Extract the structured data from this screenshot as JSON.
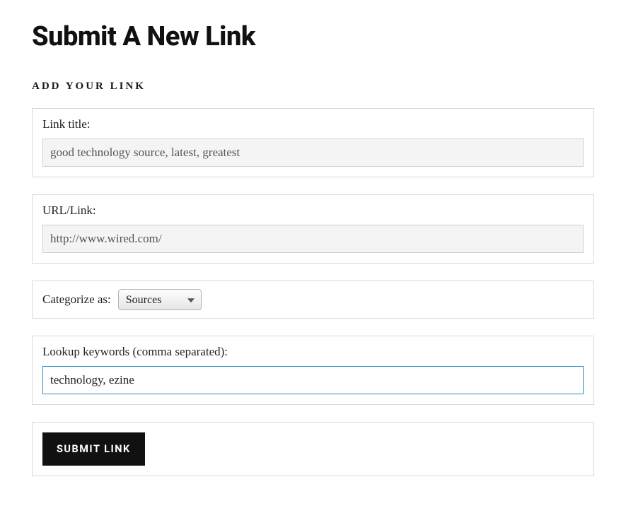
{
  "page": {
    "title": "Submit A New Link",
    "section_title": "ADD YOUR LINK"
  },
  "fields": {
    "link_title": {
      "label": "Link title:",
      "value": "good technology source, latest, greatest"
    },
    "url": {
      "label": "URL/Link:",
      "value": "http://www.wired.com/"
    },
    "category": {
      "label": "Categorize as:",
      "selected": "Sources"
    },
    "keywords": {
      "label": "Lookup keywords (comma separated):",
      "value": "technology, ezine"
    }
  },
  "submit": {
    "label": "SUBMIT LINK"
  }
}
